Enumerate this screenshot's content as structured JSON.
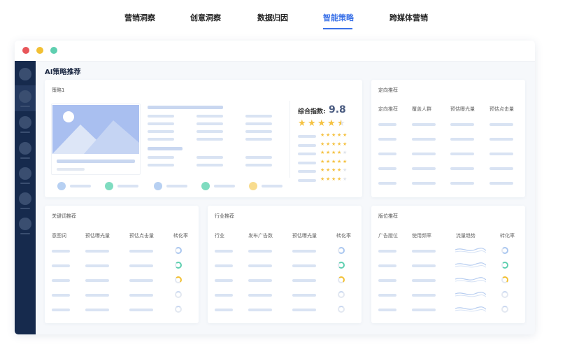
{
  "nav": {
    "tabs": [
      "营销洞察",
      "创意洞察",
      "数据归因",
      "智能策略",
      "跨媒体营销"
    ],
    "active_index": 3
  },
  "window": {
    "controls": {
      "close": "#e8565a",
      "minimize": "#f2c034",
      "maximize": "#5fcfb0"
    }
  },
  "page": {
    "title": "AI策略推荐"
  },
  "strategy": {
    "title": "策略1",
    "score_label": "综合指数:",
    "score_value": "9.8",
    "overall_stars": 4.5,
    "sub_ratings": [
      5,
      5,
      4,
      5,
      4,
      4
    ]
  },
  "targeting": {
    "title": "定向推荐",
    "columns": [
      "定向推荐",
      "覆盖人群",
      "预估曝光量",
      "预估点击量"
    ]
  },
  "keywords": {
    "title": "关键词推荐",
    "columns": [
      "意图词",
      "预估曝光量",
      "预估点击量",
      "转化率"
    ]
  },
  "industry": {
    "title": "行业推荐",
    "columns": [
      "行业",
      "发布广告数",
      "预估曝光量",
      "转化率"
    ]
  },
  "placement": {
    "title": "版位推荐",
    "columns": [
      "广告版位",
      "使用频率",
      "流量趋势",
      "转化率"
    ]
  },
  "colors": {
    "accent": "#3b72e8",
    "sidebar": "#162a4d",
    "ring_blue": "#a9c6ef",
    "ring_teal": "#5fcfb0",
    "ring_yellow": "#f2c034",
    "star": "#f5c242"
  }
}
